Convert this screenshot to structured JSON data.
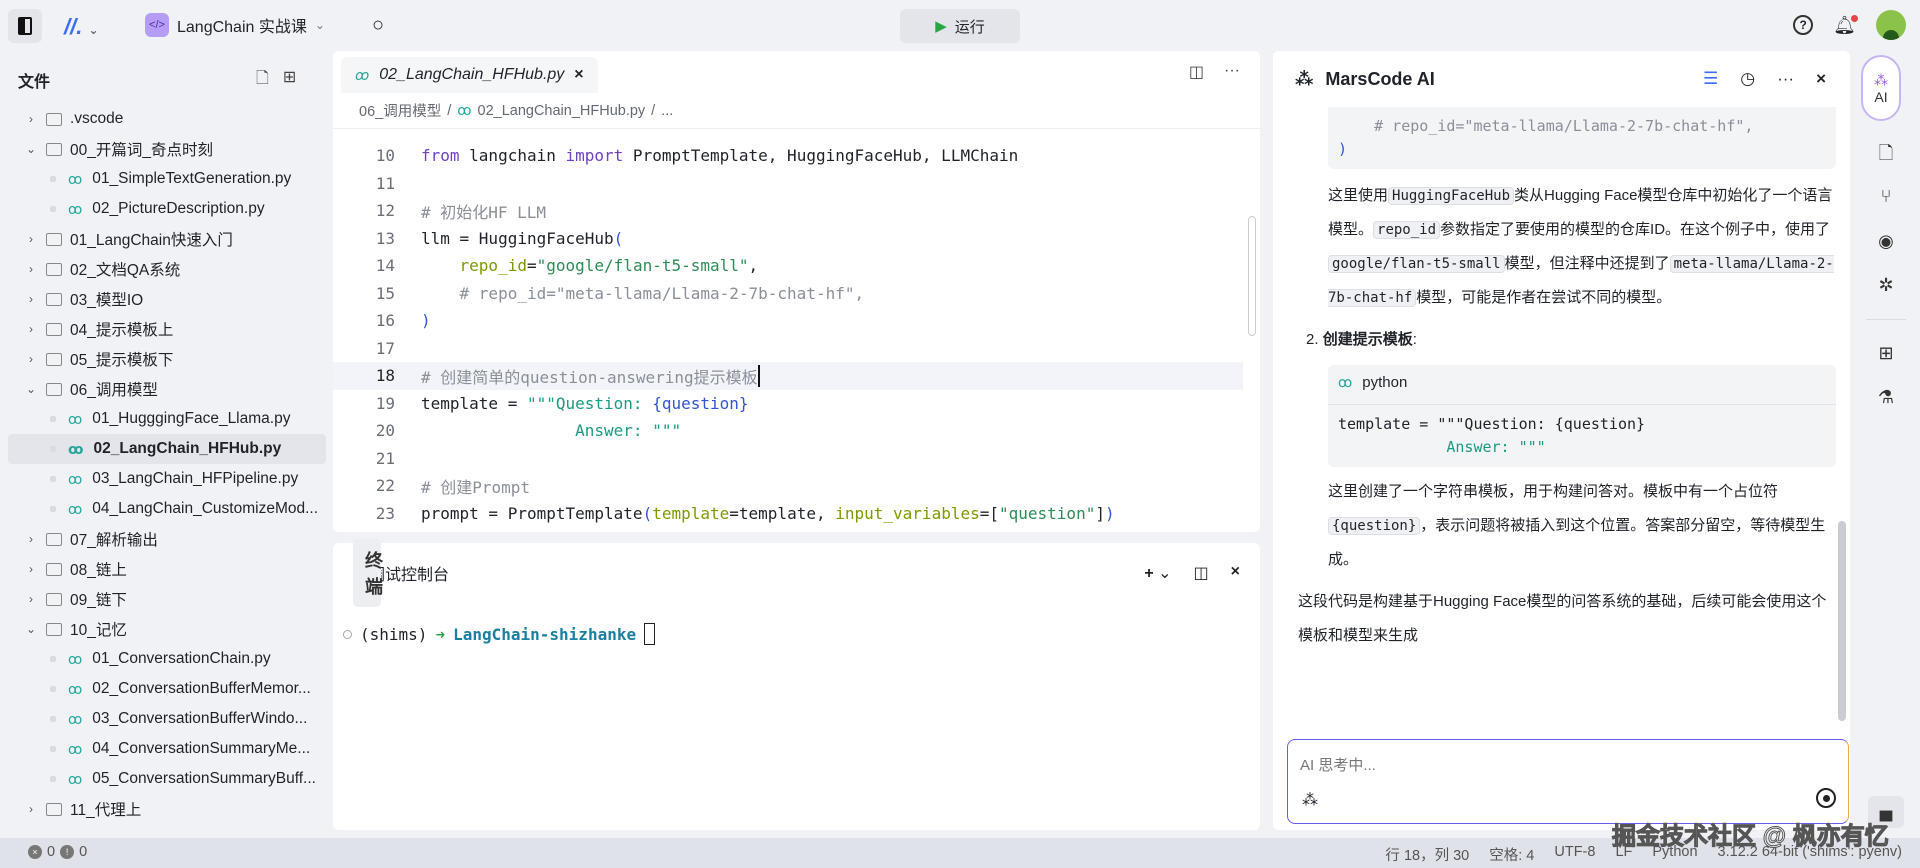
{
  "topbar": {
    "project": "LangChain 实战课",
    "run_label": "运行"
  },
  "files": {
    "title": "文件",
    "tree": [
      {
        "type": "folder",
        "open": false,
        "label": ".vscode"
      },
      {
        "type": "folder",
        "open": true,
        "label": "00_开篇词_奇点时刻"
      },
      {
        "type": "file",
        "label": "01_SimpleTextGeneration.py"
      },
      {
        "type": "file",
        "label": "02_PictureDescription.py"
      },
      {
        "type": "folder",
        "open": false,
        "label": "01_LangChain快速入门"
      },
      {
        "type": "folder",
        "open": false,
        "label": "02_文档QA系统"
      },
      {
        "type": "folder",
        "open": false,
        "label": "03_模型IO"
      },
      {
        "type": "folder",
        "open": false,
        "label": "04_提示模板上"
      },
      {
        "type": "folder",
        "open": false,
        "label": "05_提示模板下"
      },
      {
        "type": "folder",
        "open": true,
        "label": "06_调用模型"
      },
      {
        "type": "file",
        "label": "01_HugggingFace_Llama.py"
      },
      {
        "type": "file",
        "label": "02_LangChain_HFHub.py",
        "selected": true
      },
      {
        "type": "file",
        "label": "03_LangChain_HFPipeline.py"
      },
      {
        "type": "file",
        "label": "04_LangChain_CustomizeMod..."
      },
      {
        "type": "folder",
        "open": false,
        "label": "07_解析输出"
      },
      {
        "type": "folder",
        "open": false,
        "label": "08_链上"
      },
      {
        "type": "folder",
        "open": false,
        "label": "09_链下"
      },
      {
        "type": "folder",
        "open": true,
        "label": "10_记忆"
      },
      {
        "type": "file",
        "label": "01_ConversationChain.py"
      },
      {
        "type": "file",
        "label": "02_ConversationBufferMemor..."
      },
      {
        "type": "file",
        "label": "03_ConversationBufferWindo..."
      },
      {
        "type": "file",
        "label": "04_ConversationSummaryMe..."
      },
      {
        "type": "file",
        "label": "05_ConversationSummaryBuff..."
      },
      {
        "type": "folder",
        "open": false,
        "label": "11_代理上"
      }
    ]
  },
  "editor": {
    "tab": "02_LangChain_HFHub.py",
    "breadcrumb": [
      "06_调用模型",
      "02_LangChain_HFHub.py",
      "..."
    ],
    "current_line": 18,
    "lines": [
      {
        "n": "10",
        "html": "<span class='kw'>from</span> langchain <span class='kw'>import</span> PromptTemplate, HuggingFaceHub, LLMChain"
      },
      {
        "n": "11",
        "html": ""
      },
      {
        "n": "12",
        "html": "<span class='cm'># 初始化HF LLM</span>"
      },
      {
        "n": "13",
        "html": "llm = HuggingFaceHub<span class='br'>(</span>"
      },
      {
        "n": "14",
        "html": "    <span class='arg'>repo_id</span>=<span class='str'>\"google/flan-t5-small\"</span>,"
      },
      {
        "n": "15",
        "html": "    <span class='cm'># repo_id=\"meta-llama/Llama-2-7b-chat-hf\",</span>"
      },
      {
        "n": "16",
        "html": "<span class='br'>)</span>"
      },
      {
        "n": "17",
        "html": ""
      },
      {
        "n": "18",
        "html": "<span class='cm'># 创建简单的question-answering提示模板</span>"
      },
      {
        "n": "19",
        "html": "template = <span class='tq'>\"\"\"Question: </span><span class='br'>{question}</span>"
      },
      {
        "n": "20",
        "html": "                <span class='tq'>Answer: \"\"\"</span>"
      },
      {
        "n": "21",
        "html": ""
      },
      {
        "n": "22",
        "html": "<span class='cm'># 创建Prompt</span>"
      },
      {
        "n": "23",
        "html": "prompt = PromptTemplate<span class='br'>(</span><span class='arg'>template</span>=template, <span class='arg'>input_variables</span>=[<span class='str'>\"question\"</span>]<span class='br'>)</span>"
      }
    ]
  },
  "terminal": {
    "tabs": [
      "调试控制台",
      "终端"
    ],
    "active_tab": 1,
    "env": "(shims)",
    "path": "LangChain-shizhanke"
  },
  "ai": {
    "title": "MarsCode AI",
    "code1": [
      "    # repo_id=\"meta-llama/Llama-2-7b-chat-hf\",",
      ")"
    ],
    "p1": [
      "这里使用",
      "HuggingFaceHub",
      "类从Hugging Face模型仓库中初始化了一个语言模型。",
      "repo_id",
      "参数指定了要使用的模型的仓库ID。在这个例子中，使用了",
      "google/flan-t5-small",
      "模型，但注释中还提到了",
      "meta-llama/Llama-2-7b-chat-hf",
      "模型，可能是作者在尝试不同的模型。"
    ],
    "step2_num": "2.",
    "step2": "创建提示模板",
    "step2_colon": ":",
    "code2_lang": "python",
    "code2": [
      "template = \"\"\"Question: {question}",
      "            Answer: \"\"\""
    ],
    "p2": [
      "这里创建了一个字符串模板，用于构建问答对。模板中有一个占位符",
      "{question}",
      "，表示问题将被插入到这个位置。答案部分留空，等待模型生成。"
    ],
    "p3": "这段代码是构建基于Hugging Face模型的问答系统的基础，后续可能会使用这个模板和模型来生成",
    "input_placeholder": "AI 思考中..."
  },
  "activity": {
    "ai_label": "AI"
  },
  "status": {
    "errors": "0",
    "warnings": "0",
    "position": "行 18，列 30",
    "indent": "空格: 4",
    "encoding": "UTF-8",
    "eol": "LF",
    "language": "Python",
    "interpreter": "3.12.2 64-bit ('shims': pyenv)"
  },
  "watermark": "掘金技术社区 @ 枫亦有忆"
}
